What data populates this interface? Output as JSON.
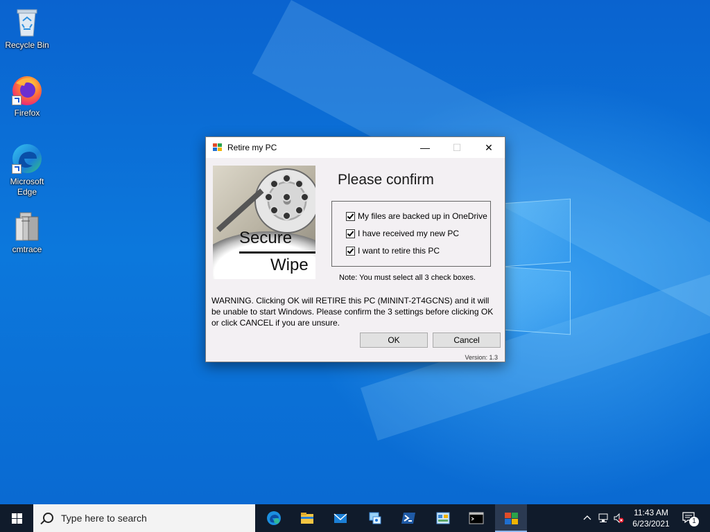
{
  "desktop": {
    "icons": [
      {
        "label": "Recycle Bin"
      },
      {
        "label": "Firefox"
      },
      {
        "label": "Microsoft Edge"
      },
      {
        "label": "cmtrace"
      }
    ]
  },
  "dialog": {
    "title": "Retire my PC",
    "minimize": "—",
    "maximize": "☐",
    "close": "✕",
    "image": {
      "line1": "Secure",
      "line2": "Wipe"
    },
    "heading": "Please confirm",
    "checkboxes": [
      {
        "label": "My files are backed up in OneDrive",
        "checked": true
      },
      {
        "label": "I have received my new PC",
        "checked": true
      },
      {
        "label": "I want to retire this PC",
        "checked": true
      }
    ],
    "note": "Note: You must select all 3 check boxes.",
    "warning": "WARNING. Clicking OK will RETIRE this PC (MININT-2T4GCNS) and it will be unable to start Windows. Please confirm the 3 settings before clicking OK or click CANCEL if you are unsure.",
    "ok_label": "OK",
    "cancel_label": "Cancel",
    "version": "Version: 1.3"
  },
  "taskbar": {
    "search_placeholder": "Type here to search",
    "apps": [
      "edge-icon",
      "file-explorer-icon",
      "mail-icon",
      "network-tool-icon",
      "powershell-icon",
      "control-panel-icon",
      "command-prompt-icon",
      "retire-my-pc-icon"
    ],
    "time": "11:43 AM",
    "date": "6/23/2021",
    "notification_count": "1"
  }
}
